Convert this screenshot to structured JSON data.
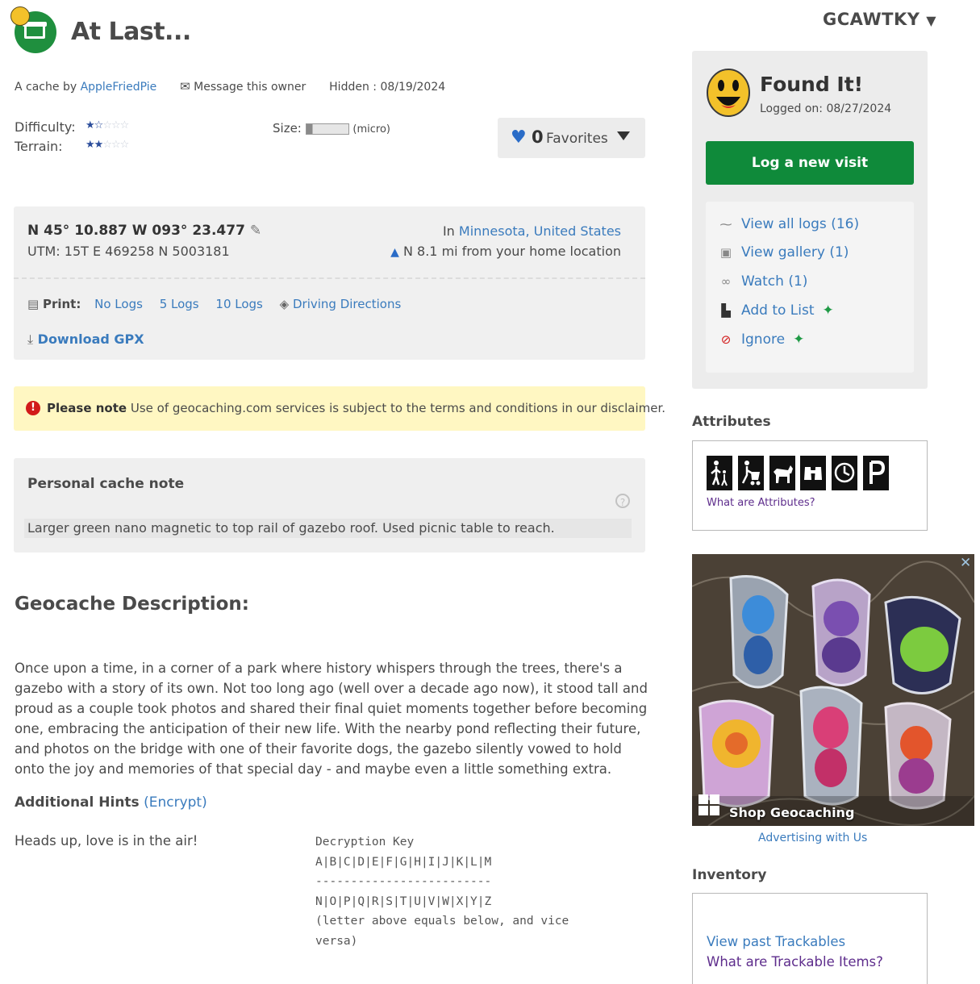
{
  "cache": {
    "title": "At Last...",
    "gc_code": "GCAWTKY",
    "by_prefix": "A cache by",
    "owner": "AppleFriedPie",
    "message_owner": "Message this owner",
    "hidden": "Hidden : 08/19/2024",
    "difficulty_label": "Difficulty:",
    "terrain_label": "Terrain:",
    "difficulty": 1.5,
    "terrain": 2,
    "size_label": "Size:",
    "size_text": "(micro)"
  },
  "favorites": {
    "count": "0",
    "label": "Favorites"
  },
  "location": {
    "coords": "N 45° 10.887 W 093° 23.477",
    "utm": "UTM: 15T E 469258 N 5003181",
    "in_prefix": "In",
    "state": "Minnesota",
    "country": "United States",
    "home_distance": "N 8.1 mi from your home location"
  },
  "print": {
    "label": "Print:",
    "options": [
      "No Logs",
      "5 Logs",
      "10 Logs"
    ],
    "driving": "Driving Directions",
    "gpx": "Download GPX"
  },
  "notice": {
    "bold": "Please note",
    "text": "Use of geocaching.com services is subject to the terms and conditions in our disclaimer."
  },
  "personal_note": {
    "title": "Personal cache note",
    "help": "?",
    "text": "Larger green nano magnetic to top rail of gazebo roof. Used picnic table to reach."
  },
  "description": {
    "heading": "Geocache Description:",
    "text": "Once upon a time, in a corner of a park where history whispers through the trees, there's a gazebo with a story of its own.  Not too long ago (well over a decade ago now), it stood tall and proud as a couple took photos and shared their final quiet moments together before becoming one, embracing the anticipation of their new life.  With the nearby pond reflecting their future, and photos on the bridge with one of their favorite dogs, the gazebo silently vowed to hold onto the joy and memories of that special day - and maybe even a little something extra."
  },
  "hints": {
    "heading": "Additional Hints",
    "encrypt": "(Encrypt)",
    "text": "Heads up, love is in the air!",
    "key_title": "Decryption Key",
    "key_row1": "A|B|C|D|E|F|G|H|I|J|K|L|M",
    "key_divider": "-------------------------",
    "key_row2": "N|O|P|Q|R|S|T|U|V|W|X|Y|Z",
    "key_note1": "(letter above equals below, and vice",
    "key_note2": "versa)"
  },
  "sidebar": {
    "found": "Found It!",
    "logged_on": "Logged on: 08/27/2024",
    "log_button": "Log a new visit",
    "view_logs": "View all logs (16)",
    "view_gallery": "View gallery (1)",
    "watch": "Watch (1)",
    "add_to_list": "Add to List",
    "ignore": "Ignore",
    "attributes_heading": "Attributes",
    "attributes": [
      "kids-icon",
      "stroller-icon",
      "dogs-icon",
      "scenic-view-icon",
      "quick-cache-icon",
      "parking-icon"
    ],
    "attributes_link": "What are Attributes?",
    "ad_caption": "Shop Geocaching",
    "ad_link": "Advertising with Us",
    "inventory_heading": "Inventory",
    "past_trackables": "View past Trackables",
    "trackable_info": "What are Trackable Items?"
  },
  "colors": {
    "brand_green": "#0f8a3a",
    "link_blue": "#3a7bbd",
    "visited_purple": "#5e2d8c",
    "notice_yellow": "#fff7c2"
  }
}
